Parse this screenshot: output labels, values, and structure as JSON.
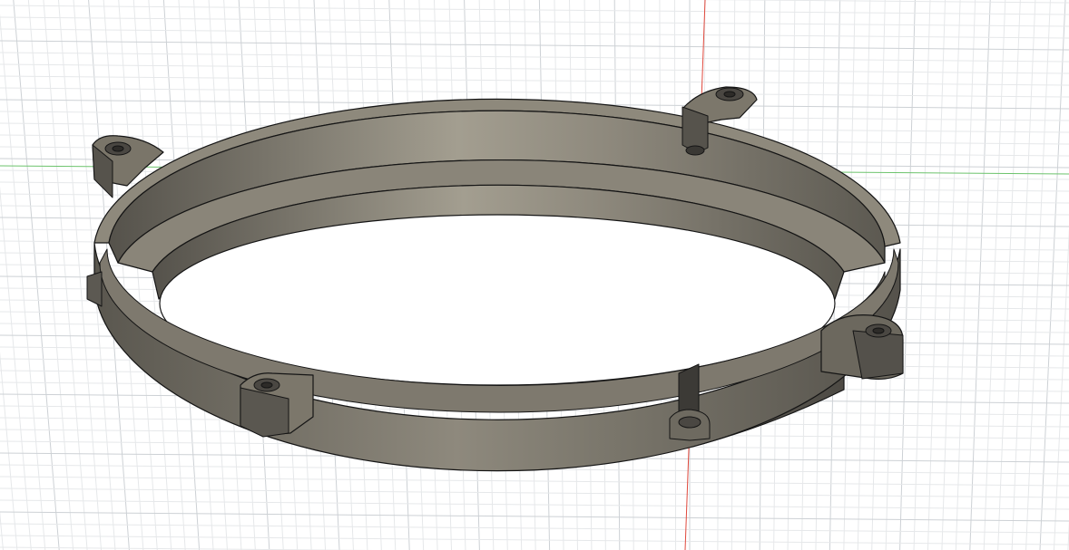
{
  "viewport": {
    "background": "#ffffff",
    "grid_minor_color": "#e6e8ea",
    "grid_major_color": "#cdd1d5",
    "x_axis_color": "#e0483c",
    "y_axis_color": "#6cc36c"
  },
  "model": {
    "body_color": "#6e6a60",
    "highlight_color": "#9c978a",
    "shadow_color": "#4b4842",
    "edge_color": "#151515",
    "mounting_tabs": 6,
    "screw_icon": "countersunk-hole-icon"
  }
}
